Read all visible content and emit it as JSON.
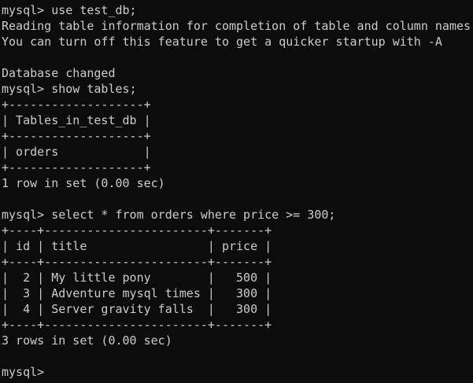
{
  "terminal": {
    "lines": [
      "mysql> use test_db;",
      "Reading table information for completion of table and column names",
      "You can turn off this feature to get a quicker startup with -A",
      "",
      "Database changed",
      "mysql> show tables;",
      "+-------------------+",
      "| Tables_in_test_db |",
      "+-------------------+",
      "| orders            |",
      "+-------------------+",
      "1 row in set (0.00 sec)",
      "",
      "mysql> select * from orders where price >= 300;",
      "+----+-----------------------+-------+",
      "| id | title                 | price |",
      "+----+-----------------------+-------+",
      "|  2 | My little pony        |   500 |",
      "|  3 | Adventure mysql times |   300 |",
      "|  4 | Server gravity falls  |   300 |",
      "+----+-----------------------+-------+",
      "3 rows in set (0.00 sec)",
      "",
      "mysql>"
    ]
  }
}
